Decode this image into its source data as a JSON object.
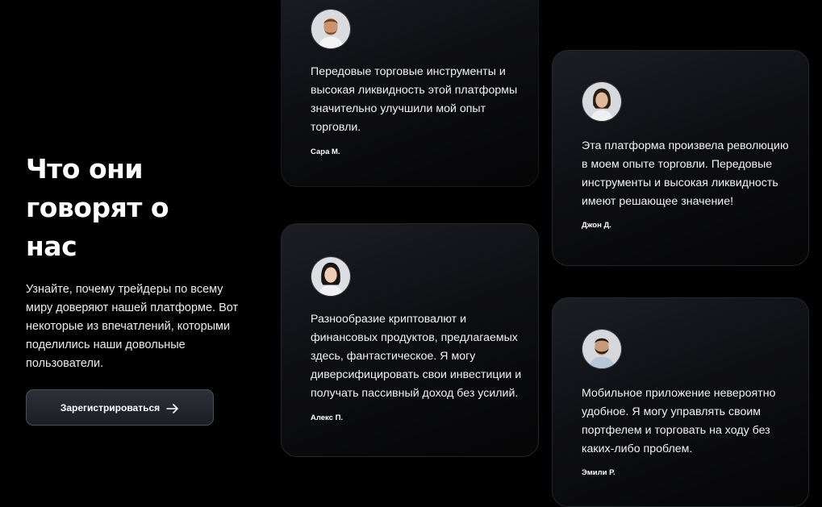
{
  "section": {
    "title": "Что они говорят о нас",
    "description": "Узнайте, почему трейдеры по всему миру доверяют нашей платформе. Вот некоторые из впечатлений, которыми поделились наши довольные пользователи.",
    "cta_label": "Зарегистрироваться",
    "cta_icon": "arrow-right-icon"
  },
  "testimonials": [
    {
      "text": "Передовые торговые инструменты и высокая ликвидность этой платформы значительно улучшили мой опыт торговли.",
      "author": "Сара М."
    },
    {
      "text": "Эта платформа произвела революцию в моем опыте торговли. Передовые инструменты и высокая ликвидность имеют решающее значение!",
      "author": "Джон Д."
    },
    {
      "text": "Разнообразие криптовалют и финансовых продуктов, предлагаемых здесь, фантастическое. Я могу диверсифицировать свои инвестиции и получать пассивный доход без усилий.",
      "author": "Алекс П."
    },
    {
      "text": "Мобильное приложение невероятно удобное. Я могу управлять своим портфелем и торговать на ходу без каких-либо проблем.",
      "author": "Эмили Р."
    }
  ]
}
